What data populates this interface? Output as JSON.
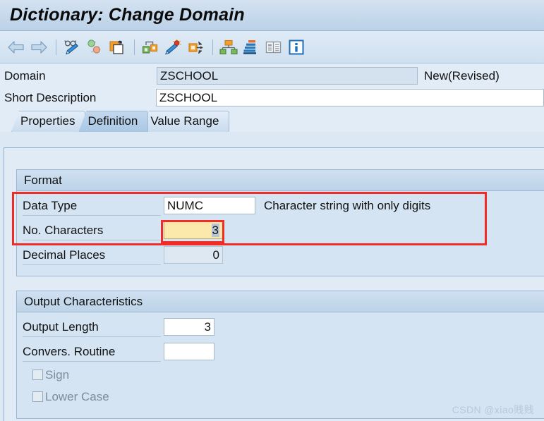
{
  "window": {
    "title": "Dictionary: Change Domain"
  },
  "toolbar": {
    "buttons": [
      {
        "name": "back-arrow-icon",
        "label": "Back"
      },
      {
        "name": "forward-arrow-icon",
        "label": "Forward"
      },
      {
        "name": "display-change-glasses-pencil-icon",
        "label": "Display <-> Change"
      },
      {
        "name": "where-used-list-icon",
        "label": "Where-Used List"
      },
      {
        "name": "copy-object-icon",
        "label": "Copy"
      },
      {
        "name": "inactive-objects-icon",
        "label": "Inactive Objects"
      },
      {
        "name": "activate-wand-icon",
        "label": "Activate"
      },
      {
        "name": "expand-object-icon",
        "label": "Expand"
      },
      {
        "name": "hierarchy-icon",
        "label": "Hierarchy"
      },
      {
        "name": "stack-overview-icon",
        "label": "Overview"
      },
      {
        "name": "documentation-icon",
        "label": "Documentation"
      },
      {
        "name": "info-icon",
        "label": "Information"
      }
    ]
  },
  "header": {
    "domain_label": "Domain",
    "domain_value": "ZSCHOOL",
    "status": "New(Revised)",
    "short_description_label": "Short Description",
    "short_description_value": "ZSCHOOL"
  },
  "tabs": [
    {
      "label": "Properties",
      "active": false
    },
    {
      "label": "Definition",
      "active": true
    },
    {
      "label": "Value Range",
      "active": false
    }
  ],
  "format": {
    "group_title": "Format",
    "data_type_label": "Data Type",
    "data_type_value": "NUMC",
    "data_type_hint": "Character string with only digits",
    "no_characters_label": "No. Characters",
    "no_characters_value": "3",
    "decimal_places_label": "Decimal Places",
    "decimal_places_value": "0"
  },
  "output": {
    "group_title": "Output Characteristics",
    "output_length_label": "Output Length",
    "output_length_value": "3",
    "convers_routine_label": "Convers. Routine",
    "convers_routine_value": "",
    "sign_label": "Sign",
    "sign_checked": false,
    "lower_case_label": "Lower Case",
    "lower_case_checked": false
  },
  "watermark": {
    "text": "CSDN @xiao贱贱"
  },
  "colors": {
    "highlight_red": "#ef2d26",
    "focus_yellow": "#fbe9ab",
    "panel_blue": "#d4e4f3",
    "titlebar_blue": "#c6d9ec"
  }
}
